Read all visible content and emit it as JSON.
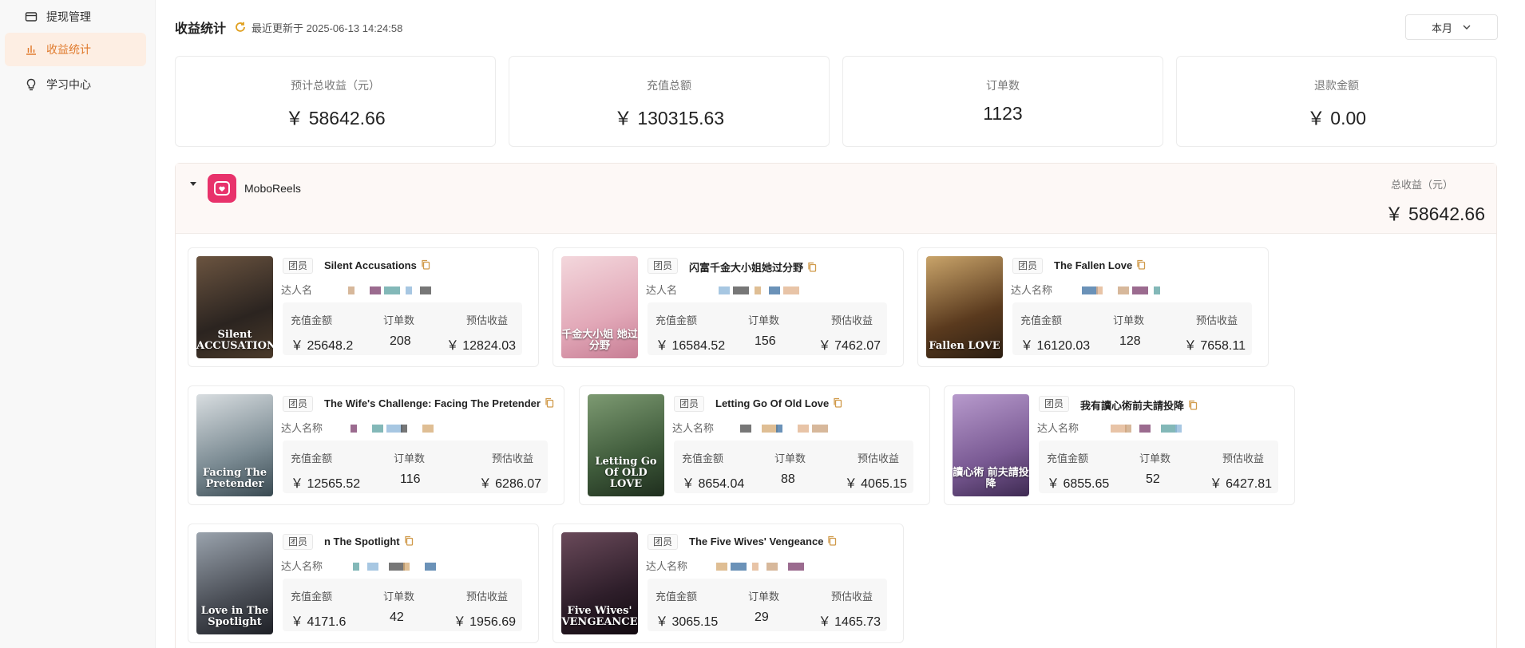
{
  "sidebar": {
    "items": [
      {
        "label": "提现管理",
        "icon": "wallet-icon",
        "active": false
      },
      {
        "label": "收益统计",
        "icon": "bar-chart-icon",
        "active": true
      },
      {
        "label": "学习中心",
        "icon": "lightbulb-icon",
        "active": false
      }
    ]
  },
  "header": {
    "title": "收益统计",
    "updated_text": "最近更新于 2025-06-13 14:24:58",
    "period": "本月"
  },
  "stats": [
    {
      "label": "预计总收益（元）",
      "value": "￥ 58642.66"
    },
    {
      "label": "充值总额",
      "value": "￥ 130315.63"
    },
    {
      "label": "订单数",
      "value": "1123"
    },
    {
      "label": "退款金额",
      "value": "￥ 0.00"
    }
  ],
  "platform": {
    "name": "MoboReels",
    "total_label": "总收益（元）",
    "total_value": "￥ 58642.66",
    "accent": "#e8326b"
  },
  "metric_labels": {
    "recharge": "充值金额",
    "orders": "订单数",
    "income": "预估收益"
  },
  "dramas": [
    {
      "tag": "团员",
      "title": "Silent Accusations",
      "talent_label": "达人名",
      "poster_text": "Silent ACCUSATIONS",
      "recharge": "￥ 25648.2",
      "orders": "208",
      "income": "￥ 12824.03"
    },
    {
      "tag": "团员",
      "title": "闪富千金大小姐她过分野",
      "talent_label": "达人名",
      "poster_text": "千金大小姐 她过分野",
      "recharge": "￥ 16584.52",
      "orders": "156",
      "income": "￥ 7462.07"
    },
    {
      "tag": "团员",
      "title": "The Fallen Love",
      "talent_label": "达人名称",
      "poster_text": "Fallen LOVE",
      "recharge": "￥ 16120.03",
      "orders": "128",
      "income": "￥ 7658.11"
    },
    {
      "tag": "团员",
      "title": "The Wife's Challenge: Facing The Pretender",
      "talent_label": "达人名称",
      "poster_text": "Facing The Pretender",
      "recharge": "￥ 12565.52",
      "orders": "116",
      "income": "￥ 6286.07"
    },
    {
      "tag": "团员",
      "title": "Letting Go Of Old Love",
      "talent_label": "达人名称",
      "poster_text": "Letting Go Of OLD LOVE",
      "recharge": "￥ 8654.04",
      "orders": "88",
      "income": "￥ 4065.15"
    },
    {
      "tag": "团员",
      "title": "我有讀心術前夫請投降",
      "talent_label": "达人名称",
      "poster_text": "讀心術 前夫請投降",
      "recharge": "￥ 6855.65",
      "orders": "52",
      "income": "￥ 6427.81"
    },
    {
      "tag": "团员",
      "title": "n The Spotlight",
      "talent_label": "达人名称",
      "poster_text": "Love in The Spotlight",
      "recharge": "￥ 4171.6",
      "orders": "42",
      "income": "￥ 1956.69"
    },
    {
      "tag": "团员",
      "title": "The Five Wives' Vengeance",
      "talent_label": "达人名称",
      "poster_text": "Five Wives' VENGEANCE",
      "recharge": "￥ 3065.15",
      "orders": "29",
      "income": "￥ 1465.73"
    }
  ]
}
